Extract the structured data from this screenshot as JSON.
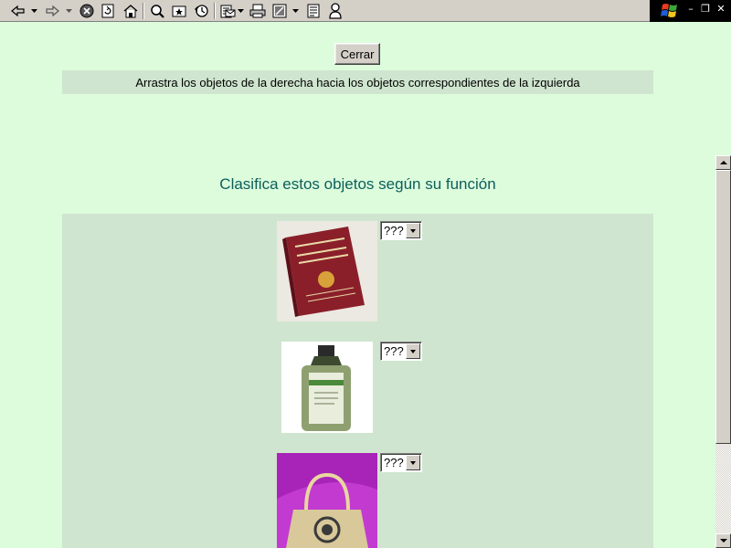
{
  "toolbar": {
    "buttons": [
      {
        "name": "back-icon"
      },
      {
        "name": "forward-icon"
      },
      {
        "name": "stop-icon"
      },
      {
        "name": "refresh-icon"
      },
      {
        "name": "home-icon"
      },
      {
        "name": "search-icon"
      },
      {
        "name": "favorites-icon"
      },
      {
        "name": "history-icon"
      },
      {
        "name": "mail-icon"
      },
      {
        "name": "print-icon"
      },
      {
        "name": "edit-icon"
      },
      {
        "name": "discuss-icon"
      },
      {
        "name": "messenger-icon"
      }
    ]
  },
  "page": {
    "close_label": "Cerrar",
    "instructions": "Arrastra los objetos de la derecha hacia los objetos correspondientes de la izquierda",
    "heading": "Clasifica estos objetos según su función",
    "items": [
      {
        "picture": "book",
        "select_value": "???"
      },
      {
        "picture": "bottle",
        "select_value": "???"
      },
      {
        "picture": "handbag",
        "select_value": "???"
      }
    ]
  },
  "colors": {
    "page_background": "#dcfcdc",
    "panel_background": "#cfe5cf",
    "heading": "#0d5e5c"
  }
}
